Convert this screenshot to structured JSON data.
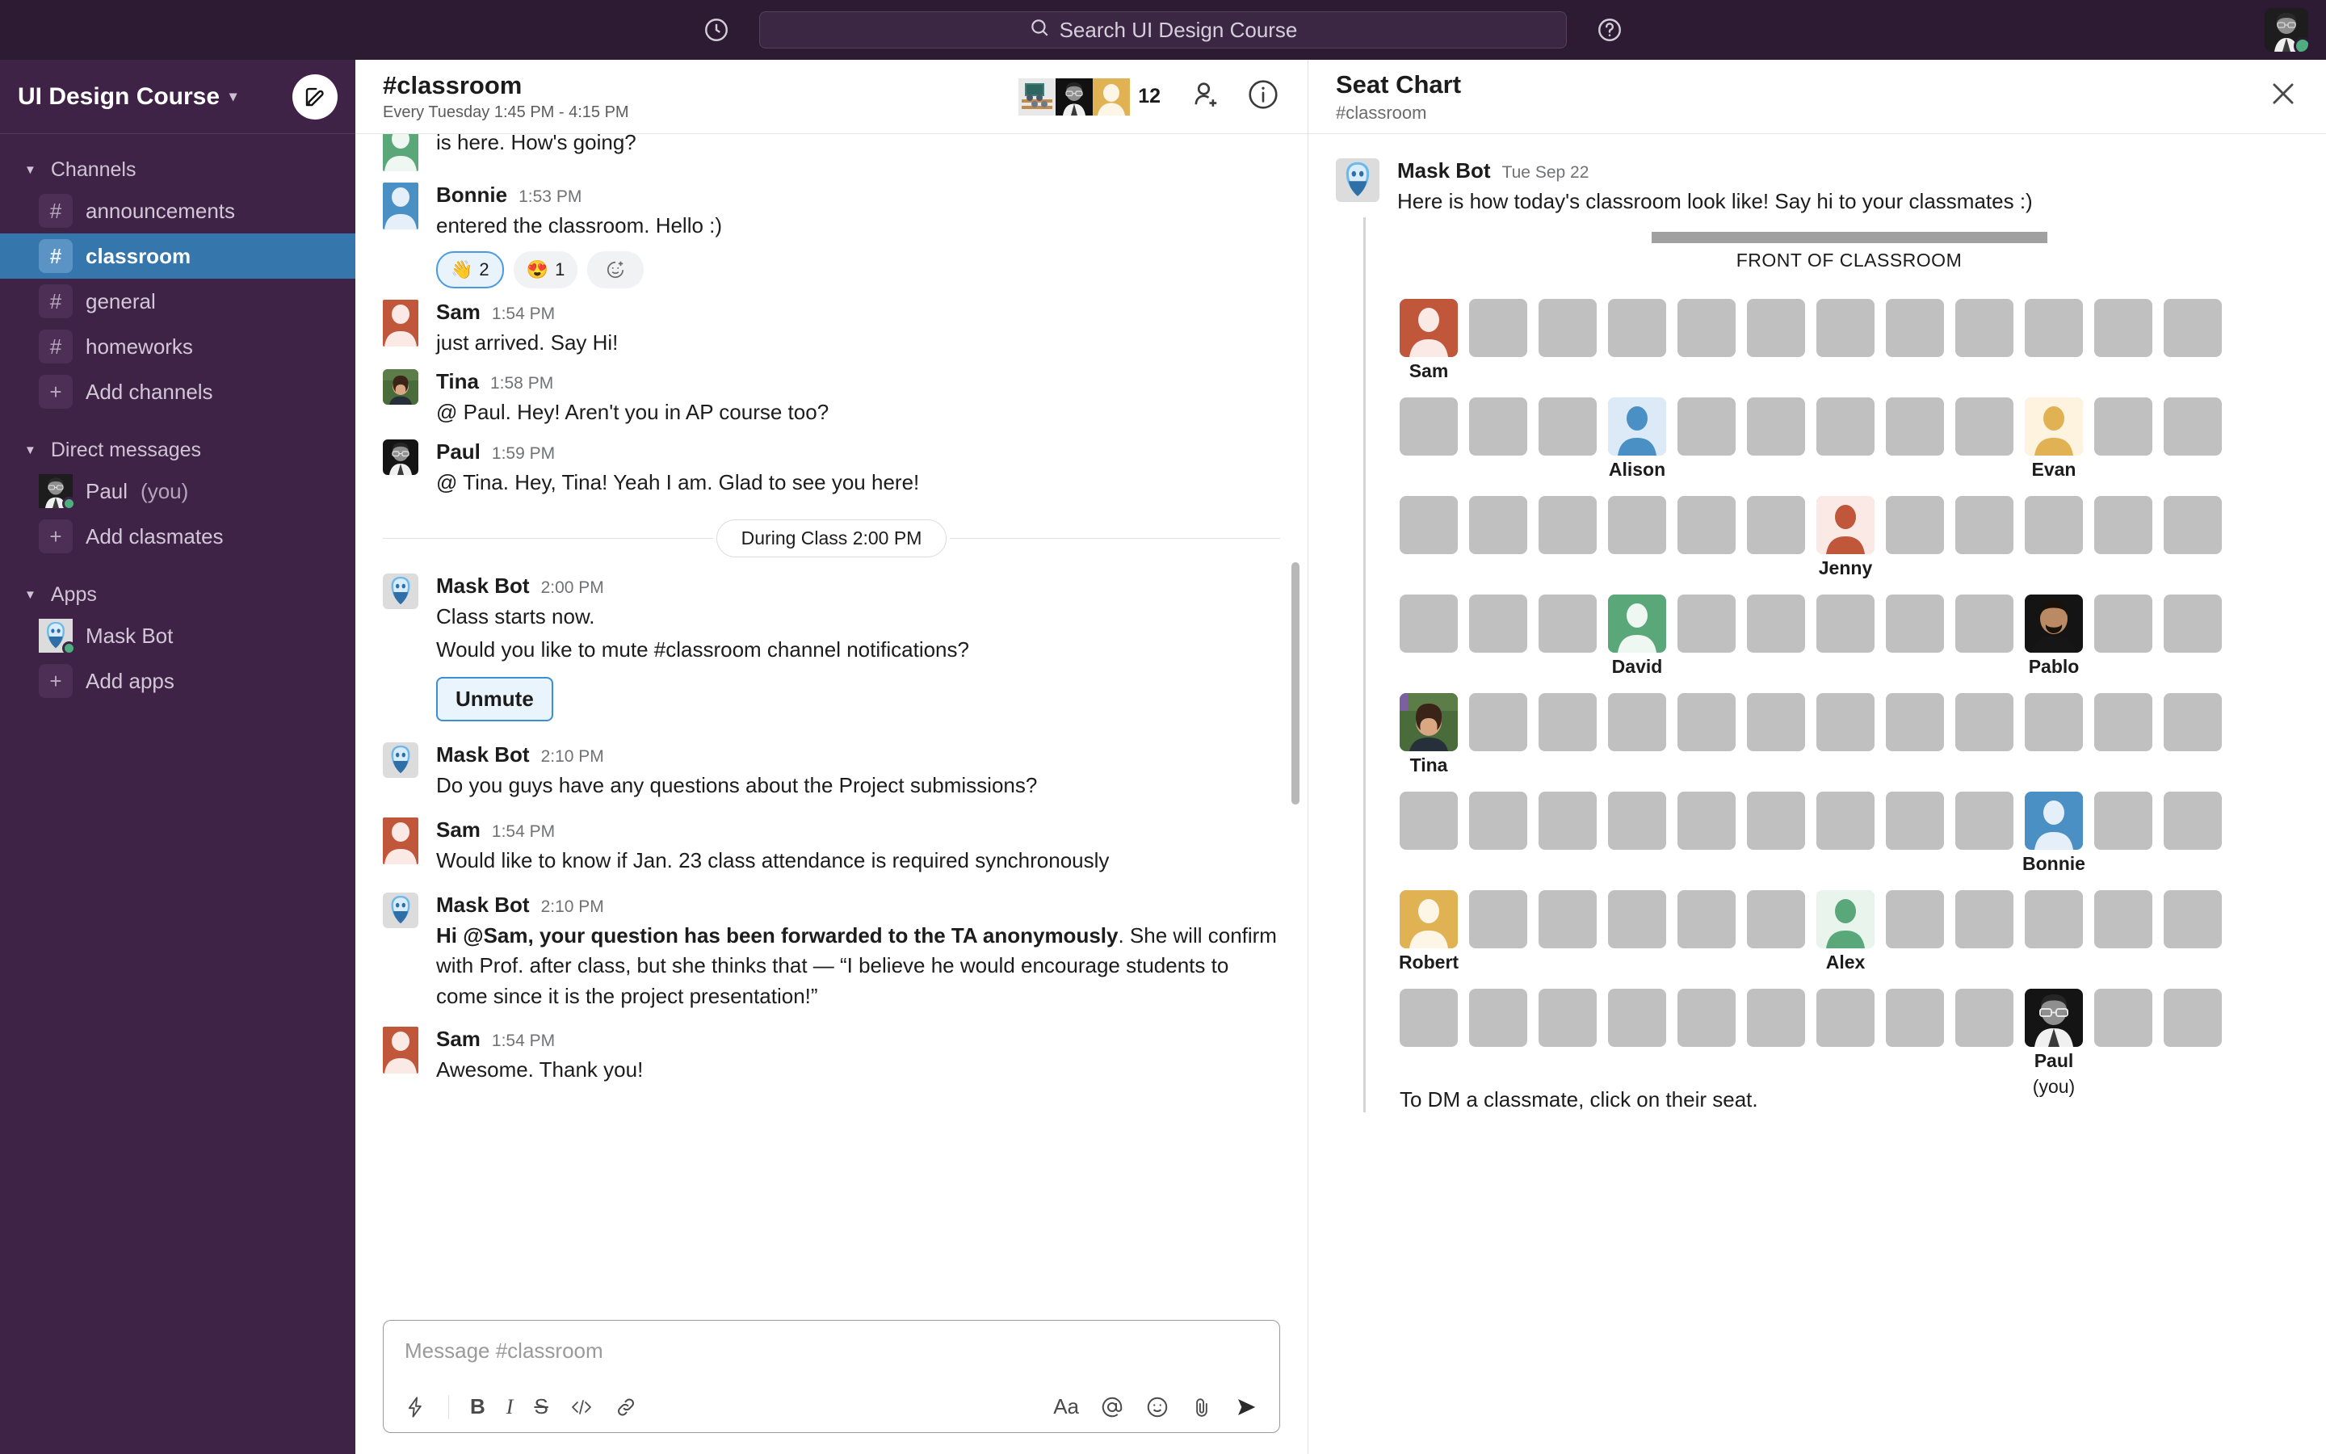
{
  "topbar": {
    "history_icon": "clock-icon",
    "search_placeholder": "Search UI Design Course",
    "search_icon": "search-icon",
    "help_icon": "help-icon",
    "user_avatar": "paul-avatar"
  },
  "sidebar": {
    "workspace": "UI Design Course",
    "compose_icon": "compose-icon",
    "sections": [
      {
        "label": "Channels",
        "items": [
          {
            "label": "announcements",
            "icon": "hash-icon",
            "active": false
          },
          {
            "label": "classroom",
            "icon": "hash-icon",
            "active": true
          },
          {
            "label": "general",
            "icon": "hash-icon",
            "active": false
          },
          {
            "label": "homeworks",
            "icon": "hash-icon",
            "active": false
          },
          {
            "label": "Add channels",
            "icon": "plus-icon",
            "active": false
          }
        ]
      },
      {
        "label": "Direct messages",
        "items": [
          {
            "label": "Paul",
            "suffix": "(you)",
            "icon": "avatar-photo",
            "active": false
          },
          {
            "label": "Add clasmates",
            "icon": "plus-icon",
            "active": false
          }
        ]
      },
      {
        "label": "Apps",
        "items": [
          {
            "label": "Mask Bot",
            "icon": "maskbot-icon",
            "active": false
          },
          {
            "label": "Add apps",
            "icon": "plus-icon",
            "active": false
          }
        ]
      }
    ]
  },
  "channel": {
    "title": "#classroom",
    "schedule": "Every Tuesday 1:45 PM - 4:15 PM",
    "member_count": "12",
    "add_member_icon": "add-person-icon",
    "info_icon": "info-icon"
  },
  "messages": [
    {
      "name": "",
      "time": "",
      "text": "is here. How's going?",
      "avatar": "green-person",
      "partial": true
    },
    {
      "name": "Bonnie",
      "time": "1:53 PM",
      "text": "entered the classroom. Hello :)",
      "avatar": "blue-person",
      "reactions": [
        {
          "emoji": "👋",
          "count": "2",
          "selected": true
        },
        {
          "emoji": "😍",
          "count": "1",
          "selected": false
        },
        {
          "emoji": "add-reaction-icon",
          "count": "",
          "selected": false
        }
      ]
    },
    {
      "name": "Sam",
      "time": "1:54 PM",
      "text": "just arrived. Say Hi!",
      "avatar": "orange-person"
    },
    {
      "name": "Tina",
      "time": "1:58 PM",
      "text": "@ Paul. Hey! Aren't you in AP course too?",
      "avatar": "tina-photo"
    },
    {
      "name": "Paul",
      "time": "1:59 PM",
      "text": "@ Tina. Hey, Tina! Yeah I am. Glad to see you here!",
      "avatar": "paul-photo"
    }
  ],
  "day_divider": "During Class 2:00 PM",
  "messages2": [
    {
      "name": "Mask Bot",
      "time": "2:00 PM",
      "line1": "Class starts now.",
      "line2": "Would you like to mute #classroom channel notifications?",
      "button": "Unmute",
      "avatar": "maskbot-icon"
    },
    {
      "name": "Mask Bot",
      "time": "2:10 PM",
      "text": "Do you guys have any questions about the Project submissions?",
      "avatar": "maskbot-icon"
    },
    {
      "name": "Sam",
      "time": "1:54 PM",
      "text": "Would like to know if Jan. 23 class attendance is required synchronously",
      "avatar": "orange-person"
    },
    {
      "name": "Mask Bot",
      "time": "2:10 PM",
      "bold_part": "Hi @Sam, your question has been forwarded to the TA anonymously",
      "rest": ". She will confirm with Prof. after class, but she thinks that — “I believe he would encourage students to come since it is the project presentation!”",
      "avatar": "maskbot-icon"
    },
    {
      "name": "Sam",
      "time": "1:54 PM",
      "text": "Awesome. Thank you!",
      "avatar": "orange-person"
    }
  ],
  "composer": {
    "placeholder": "Message #classroom",
    "tools_left": [
      "lightning-icon",
      "bold-icon",
      "italic-icon",
      "strikethrough-icon",
      "code-icon",
      "link-icon"
    ],
    "tools_right": [
      "text-format-icon",
      "mention-icon",
      "emoji-icon",
      "attach-icon",
      "send-icon"
    ]
  },
  "panel": {
    "title": "Seat Chart",
    "subtitle": "#classroom",
    "close_icon": "close-icon",
    "bot_name": "Mask Bot",
    "bot_date": "Tue Sep 22",
    "bot_message": "Here is how today's classroom look like! Say hi to your classmates :)",
    "front_label": "FRONT OF CLASSROOM",
    "hint": "To DM a classmate, click on their seat.",
    "columns": 12,
    "seats": [
      {
        "row": 0,
        "col": 0,
        "name": "Sam",
        "style": "orange-solid"
      },
      {
        "row": 1,
        "col": 3,
        "name": "Alison",
        "style": "blue-light"
      },
      {
        "row": 1,
        "col": 9,
        "name": "Evan",
        "style": "gold-light"
      },
      {
        "row": 2,
        "col": 6,
        "name": "Jenny",
        "style": "red-light"
      },
      {
        "row": 3,
        "col": 3,
        "name": "David",
        "style": "green-solid"
      },
      {
        "row": 3,
        "col": 9,
        "name": "Pablo",
        "style": "photo-pablo"
      },
      {
        "row": 4,
        "col": 0,
        "name": "Tina",
        "style": "photo-tina"
      },
      {
        "row": 5,
        "col": 9,
        "name": "Bonnie",
        "style": "blue-solid"
      },
      {
        "row": 6,
        "col": 0,
        "name": "Robert",
        "style": "gold-solid"
      },
      {
        "row": 6,
        "col": 6,
        "name": "Alex",
        "style": "green-light"
      },
      {
        "row": 7,
        "col": 9,
        "name": "Paul",
        "suffix": "(you)",
        "style": "photo-paul"
      }
    ],
    "rows": 8
  },
  "colors": {
    "sidebar_bg": "#3f2347",
    "topbar_bg": "#2c1b33",
    "active_channel": "#3576ad",
    "seat_empty": "#c0c0c0",
    "presence_green": "#4fae7f"
  }
}
